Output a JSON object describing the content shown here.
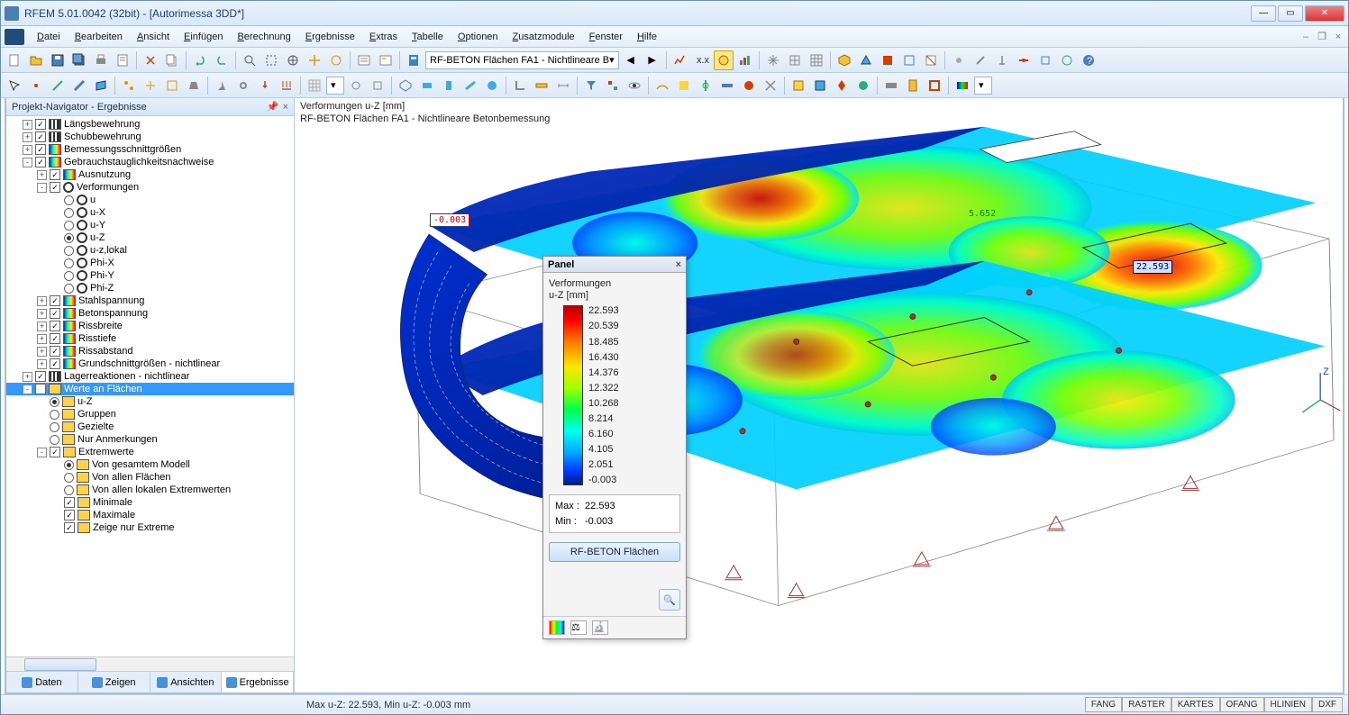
{
  "window": {
    "title": "RFEM 5.01.0042 (32bit) - [Autorimessa 3DD*]"
  },
  "menu": [
    "Datei",
    "Bearbeiten",
    "Ansicht",
    "Einfügen",
    "Berechnung",
    "Ergebnisse",
    "Extras",
    "Tabelle",
    "Optionen",
    "Zusatzmodule",
    "Fenster",
    "Hilfe"
  ],
  "toolbar_combo": "RF-BETON Flächen FA1 - Nichtlineare B",
  "navigator": {
    "title": "Projekt-Navigator - Ergebnisse",
    "items": [
      {
        "lvl": 1,
        "tgl": "+",
        "chk": true,
        "icon": "bars",
        "label": "Längsbewehrung"
      },
      {
        "lvl": 1,
        "tgl": "+",
        "chk": true,
        "icon": "bars",
        "label": "Schubbewehrung"
      },
      {
        "lvl": 1,
        "tgl": "+",
        "chk": true,
        "icon": "grad",
        "label": "Bemessungsschnittgrößen"
      },
      {
        "lvl": 1,
        "tgl": "-",
        "chk": true,
        "icon": "grad",
        "label": "Gebrauchstauglichkeitsnachweise"
      },
      {
        "lvl": 2,
        "tgl": "+",
        "chk": true,
        "icon": "grad",
        "label": "Ausnutzung"
      },
      {
        "lvl": 2,
        "tgl": "-",
        "chk": true,
        "icon": "donut",
        "label": "Verformungen"
      },
      {
        "lvl": 3,
        "radio": false,
        "icon": "donut",
        "label": "u"
      },
      {
        "lvl": 3,
        "radio": false,
        "icon": "donut",
        "label": "u-X"
      },
      {
        "lvl": 3,
        "radio": false,
        "icon": "donut",
        "label": "u-Y"
      },
      {
        "lvl": 3,
        "radio": true,
        "icon": "donut",
        "label": "u-Z"
      },
      {
        "lvl": 3,
        "radio": false,
        "icon": "donut",
        "label": "u-z,lokal"
      },
      {
        "lvl": 3,
        "radio": false,
        "icon": "donut",
        "label": "Phi-X"
      },
      {
        "lvl": 3,
        "radio": false,
        "icon": "donut",
        "label": "Phi-Y"
      },
      {
        "lvl": 3,
        "radio": false,
        "icon": "donut",
        "label": "Phi-Z"
      },
      {
        "lvl": 2,
        "tgl": "+",
        "chk": true,
        "icon": "grad",
        "label": "Stahlspannung"
      },
      {
        "lvl": 2,
        "tgl": "+",
        "chk": true,
        "icon": "grad",
        "label": "Betonspannung"
      },
      {
        "lvl": 2,
        "tgl": "+",
        "chk": true,
        "icon": "grad",
        "label": "Rissbreite"
      },
      {
        "lvl": 2,
        "tgl": "+",
        "chk": true,
        "icon": "grad",
        "label": "Risstiefe"
      },
      {
        "lvl": 2,
        "tgl": "+",
        "chk": true,
        "icon": "grad",
        "label": "Rissabstand"
      },
      {
        "lvl": 2,
        "tgl": "+",
        "chk": true,
        "icon": "grad",
        "label": "Grundschnittgrößen - nichtlinear"
      },
      {
        "lvl": 1,
        "tgl": "+",
        "chk": true,
        "icon": "bars",
        "label": "Lagerreaktionen - nichtlinear"
      },
      {
        "lvl": 1,
        "tgl": "-",
        "chk": true,
        "icon": "grid",
        "label": "Werte an Flächen",
        "selected": true
      },
      {
        "lvl": 2,
        "radio": true,
        "icon": "grid",
        "label": "u-Z"
      },
      {
        "lvl": 2,
        "radio": false,
        "icon": "grid",
        "label": "Gruppen"
      },
      {
        "lvl": 2,
        "radio": false,
        "icon": "grid",
        "label": "Gezielte"
      },
      {
        "lvl": 2,
        "radio": false,
        "icon": "grid",
        "label": "Nur Anmerkungen"
      },
      {
        "lvl": 2,
        "tgl": "-",
        "chk": true,
        "icon": "grid",
        "label": "Extremwerte"
      },
      {
        "lvl": 3,
        "radio": true,
        "icon": "grid",
        "label": "Von gesamtem Modell"
      },
      {
        "lvl": 3,
        "radio": false,
        "icon": "grid",
        "label": "Von allen Flächen"
      },
      {
        "lvl": 3,
        "radio": false,
        "icon": "grid",
        "label": "Von allen lokalen Extremwerten"
      },
      {
        "lvl": 3,
        "chk": true,
        "icon": "grid",
        "label": "Minimale"
      },
      {
        "lvl": 3,
        "chk": true,
        "icon": "grid",
        "label": "Maximale"
      },
      {
        "lvl": 3,
        "chk": true,
        "icon": "grid",
        "label": "Zeige nur Extreme"
      }
    ],
    "tabs": [
      "Daten",
      "Zeigen",
      "Ansichten",
      "Ergebnisse"
    ],
    "active_tab": 3
  },
  "view": {
    "header_line1": "Verformungen u-Z [mm]",
    "header_line2": "RF-BETON Flächen FA1 - Nichtlineare Betonbemessung",
    "annot_min": "-0.003",
    "annot_mid": "5.652",
    "annot_max": "22.593"
  },
  "panel": {
    "title": "Panel",
    "label1": "Verformungen",
    "label2": "u-Z [mm]",
    "legend_values": [
      "22.593",
      "20.539",
      "18.485",
      "16.430",
      "14.376",
      "12.322",
      "10.268",
      "8.214",
      "6.160",
      "4.105",
      "2.051",
      "-0.003"
    ],
    "max_label": "Max :",
    "max_val": "22.593",
    "min_label": "Min :",
    "min_val": "-0.003",
    "button": "RF-BETON Flächen"
  },
  "statusbar": {
    "main": "Max u-Z: 22.593, Min u-Z: -0.003 mm",
    "toggles": [
      "FANG",
      "RASTER",
      "KARTES",
      "OFANG",
      "HLINIEN",
      "DXF"
    ]
  }
}
